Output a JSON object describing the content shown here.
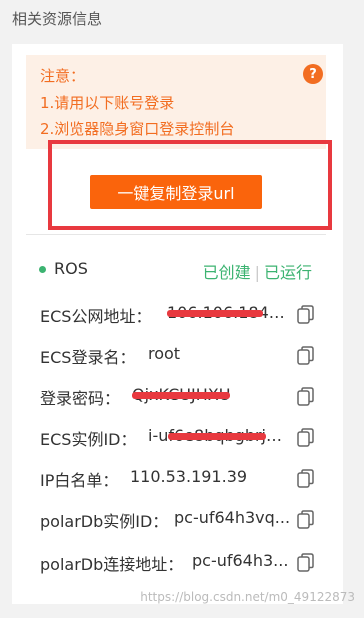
{
  "section_title": "相关资源信息",
  "notice": {
    "heading": "注意：",
    "lines": [
      "1.请用以下账号登录",
      "2.浏览器隐身窗口登录控制台"
    ],
    "help_glyph": "?"
  },
  "copy_button": {
    "label": "一键复制登录url"
  },
  "resource": {
    "name": "ROS",
    "status_created": "已创建",
    "status_running": "已运行"
  },
  "rows": [
    {
      "label": "ECS公网地址：",
      "value": "106.106.184...."
    },
    {
      "label": "ECS登录名：",
      "value": "root"
    },
    {
      "label": "登录密码：",
      "value": "QjxKCUJHXU"
    },
    {
      "label": "ECS实例ID：",
      "value": "i-uf6e8bqbgbrj4..."
    },
    {
      "label": "IP白名单：",
      "value": "110.53.191.39"
    },
    {
      "label": "polarDb实例ID：",
      "value": "pc-uf64h3vq..."
    },
    {
      "label": "polarDb连接地址：",
      "value": "pc-uf64h3..."
    }
  ],
  "copy_icon_name": "copy-icon",
  "watermark": "https://blog.csdn.net/m0_49122873",
  "colors": {
    "accent_orange": "#fa640c",
    "notice_bg": "#fdf0e6",
    "status_green": "#3cb371",
    "redaction_red": "#e8393f"
  }
}
